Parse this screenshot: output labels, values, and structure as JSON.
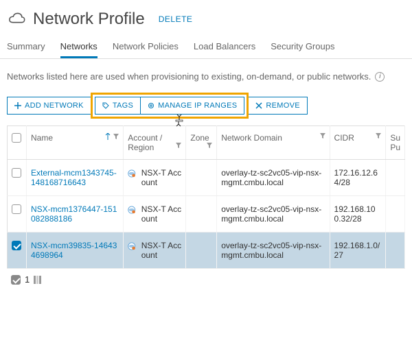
{
  "header": {
    "title": "Network Profile",
    "delete_label": "DELETE"
  },
  "tabs": {
    "summary": "Summary",
    "networks": "Networks",
    "policies": "Network Policies",
    "load_balancers": "Load Balancers",
    "security_groups": "Security Groups"
  },
  "description": "Networks listed here are used when provisioning to existing, on-demand, or public networks.",
  "toolbar": {
    "add_network": "ADD NETWORK",
    "tags": "TAGS",
    "manage_ip": "MANAGE IP RANGES",
    "remove": "REMOVE"
  },
  "columns": {
    "name": "Name",
    "account": "Account / Region",
    "zone": "Zone",
    "domain": "Network Domain",
    "cidr": "CIDR",
    "su": "Su Pu"
  },
  "rows": [
    {
      "name": "External-mcm1343745-148168716643",
      "account": "NSX-T Account",
      "zone": "",
      "domain": "overlay-tz-sc2vc05-vip-nsx-mgmt.cmbu.local",
      "cidr": "172.16.12.64/28",
      "selected": false
    },
    {
      "name": "NSX-mcm1376447-151082888186",
      "account": "NSX-T Account",
      "zone": "",
      "domain": "overlay-tz-sc2vc05-vip-nsx-mgmt.cmbu.local",
      "cidr": "192.168.100.32/28",
      "selected": false
    },
    {
      "name": "NSX-mcm39835-146434698964",
      "account": "NSX-T Account",
      "zone": "",
      "domain": "overlay-tz-sc2vc05-vip-nsx-mgmt.cmbu.local",
      "cidr": "192.168.1.0/27",
      "selected": true
    }
  ],
  "footer": {
    "count": "1"
  }
}
